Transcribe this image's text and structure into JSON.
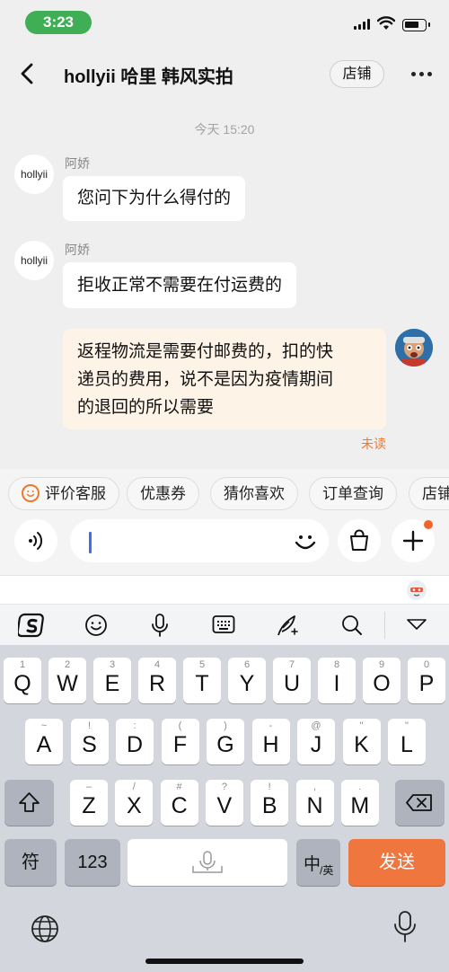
{
  "status_bar": {
    "time": "3:23",
    "time_color": "#3fae54"
  },
  "header": {
    "title": "hollyii 哈里 韩风实拍",
    "store_button": "店铺"
  },
  "chat": {
    "timestamp": "今天 15:20",
    "messages": [
      {
        "sender": "阿娇",
        "avatar_text": "hollyii",
        "text": "您问下为什么得付的"
      },
      {
        "sender": "阿娇",
        "avatar_text": "hollyii",
        "text": "拒收正常不需要在付运费的"
      }
    ],
    "my_message": {
      "lines": [
        "返程物流是需要付邮费的，扣的快",
        "递员的费用，说不是因为疫情期间",
        "的退回的所以需要"
      ],
      "status": "未读"
    }
  },
  "quick_chips": [
    "评价客服",
    "优惠券",
    "猜你喜欢",
    "订单查询",
    "店铺"
  ],
  "keyboard": {
    "row1": [
      {
        "key": "Q",
        "sub": "1"
      },
      {
        "key": "W",
        "sub": "2"
      },
      {
        "key": "E",
        "sub": "3"
      },
      {
        "key": "R",
        "sub": "4"
      },
      {
        "key": "T",
        "sub": "5"
      },
      {
        "key": "Y",
        "sub": "6"
      },
      {
        "key": "U",
        "sub": "7"
      },
      {
        "key": "I",
        "sub": "8"
      },
      {
        "key": "O",
        "sub": "9"
      },
      {
        "key": "P",
        "sub": "0"
      }
    ],
    "row2": [
      {
        "key": "A",
        "sub": "~"
      },
      {
        "key": "S",
        "sub": "!"
      },
      {
        "key": "D",
        "sub": ":"
      },
      {
        "key": "F",
        "sub": "("
      },
      {
        "key": "G",
        "sub": ")"
      },
      {
        "key": "H",
        "sub": "-"
      },
      {
        "key": "J",
        "sub": "@"
      },
      {
        "key": "K",
        "sub": "\""
      },
      {
        "key": "L",
        "sub": "\""
      }
    ],
    "row3": [
      {
        "key": "Z",
        "sub": "–"
      },
      {
        "key": "X",
        "sub": "/"
      },
      {
        "key": "C",
        "sub": "#"
      },
      {
        "key": "V",
        "sub": "?"
      },
      {
        "key": "B",
        "sub": "!"
      },
      {
        "key": "N",
        "sub": ","
      },
      {
        "key": "M",
        "sub": "."
      }
    ],
    "symbol_key": "符",
    "number_key": "123",
    "lang_key_main": "中",
    "lang_key_sub": "/英",
    "send_key": "发送",
    "accent_color": "#f0763f"
  }
}
